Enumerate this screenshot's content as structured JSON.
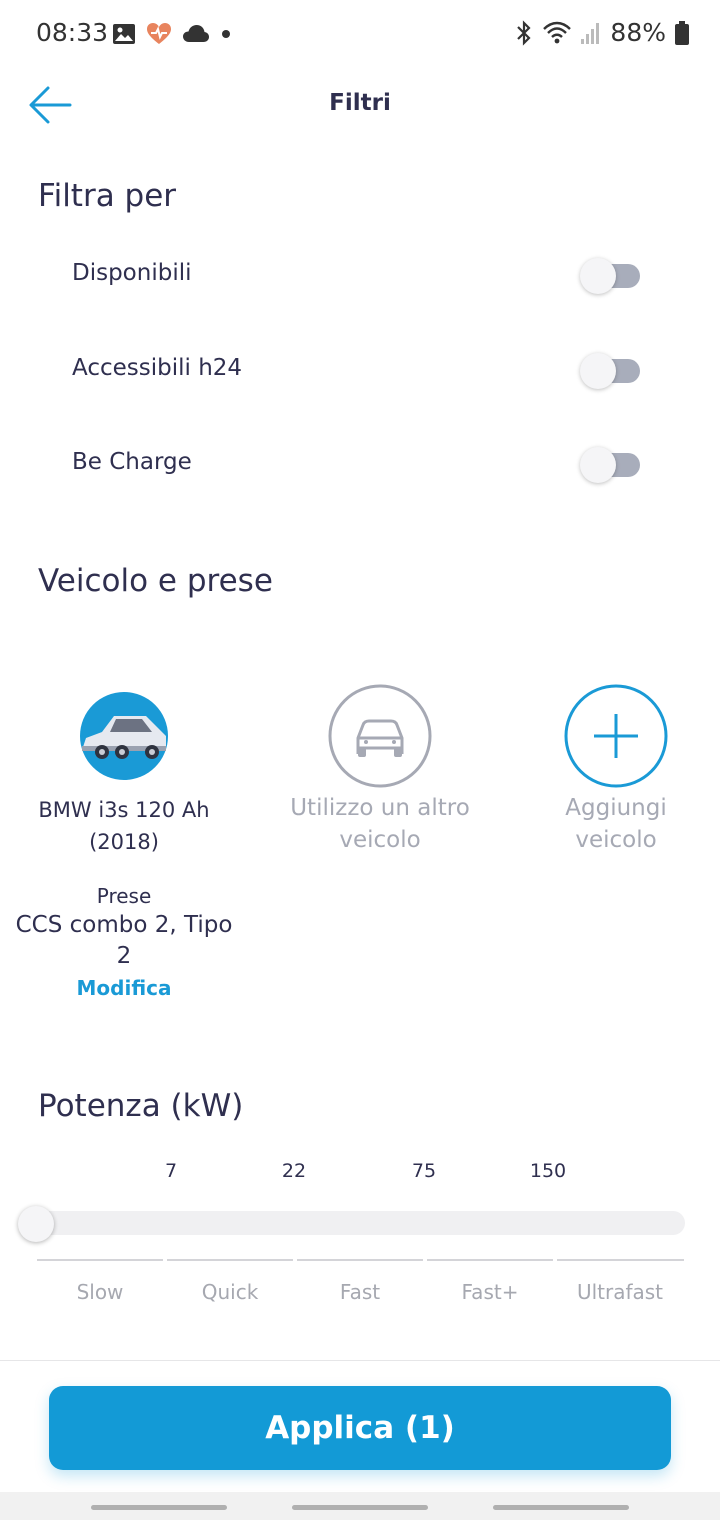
{
  "status_bar": {
    "time": "08:33",
    "battery": "88%",
    "left_icons": [
      "image-icon",
      "health-heart-icon",
      "cloud-icon",
      "dot-icon"
    ],
    "right_icons": [
      "bluetooth-icon",
      "wifi-icon",
      "signal-icon",
      "battery-icon"
    ]
  },
  "header": {
    "title": "Filtri",
    "back_icon": "back-arrow-icon",
    "accent_color": "#1a9ad6"
  },
  "filters": {
    "title": "Filtra per",
    "items": [
      {
        "label": "Disponibili",
        "enabled": false
      },
      {
        "label": "Accessibili h24",
        "enabled": false
      },
      {
        "label": "Be Charge",
        "enabled": false
      }
    ]
  },
  "vehicles": {
    "title": "Veicolo e prese",
    "items": [
      {
        "line1": "BMW i3s 120 Ah",
        "line2": "(2018)",
        "icon": "car-photo-icon",
        "selected": true
      },
      {
        "line1": "Utilizzo un altro",
        "line2": "veicolo",
        "icon": "car-outline-icon",
        "selected": false
      },
      {
        "line1": "Aggiungi",
        "line2": "veicolo",
        "icon": "plus-circle-icon",
        "selected": false
      }
    ],
    "plugs": {
      "title": "Prese",
      "line1": "CCS combo 2, Tipo",
      "line2": "2",
      "edit_label": "Modifica"
    }
  },
  "power": {
    "title": "Potenza (kW)",
    "ticks": [
      "7",
      "22",
      "75",
      "150"
    ],
    "slider_value": "0",
    "categories": [
      "Slow",
      "Quick",
      "Fast",
      "Fast+",
      "Ultrafast"
    ]
  },
  "footer": {
    "apply_label": "Applica (1)",
    "button_color": "#139ad6"
  }
}
